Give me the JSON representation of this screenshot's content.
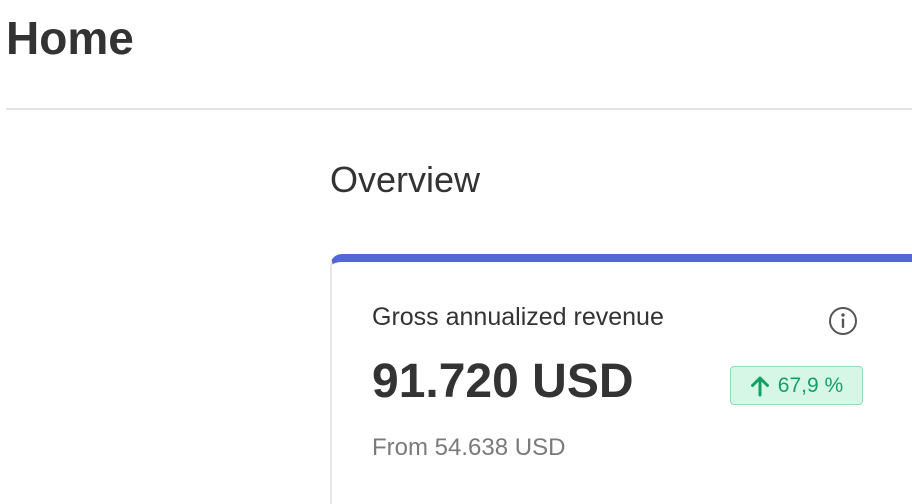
{
  "header": {
    "title": "Home"
  },
  "overview": {
    "title": "Overview",
    "card": {
      "label": "Gross annualized revenue",
      "info_icon": "info-circle-icon",
      "value": "91.720 USD",
      "change": {
        "direction": "up",
        "icon": "arrow-up-icon",
        "text": "67,9 %",
        "color": "#15a068",
        "background": "#d6f7e6"
      },
      "comparison": "From 54.638 USD",
      "accent_color": "#5465d6"
    }
  }
}
